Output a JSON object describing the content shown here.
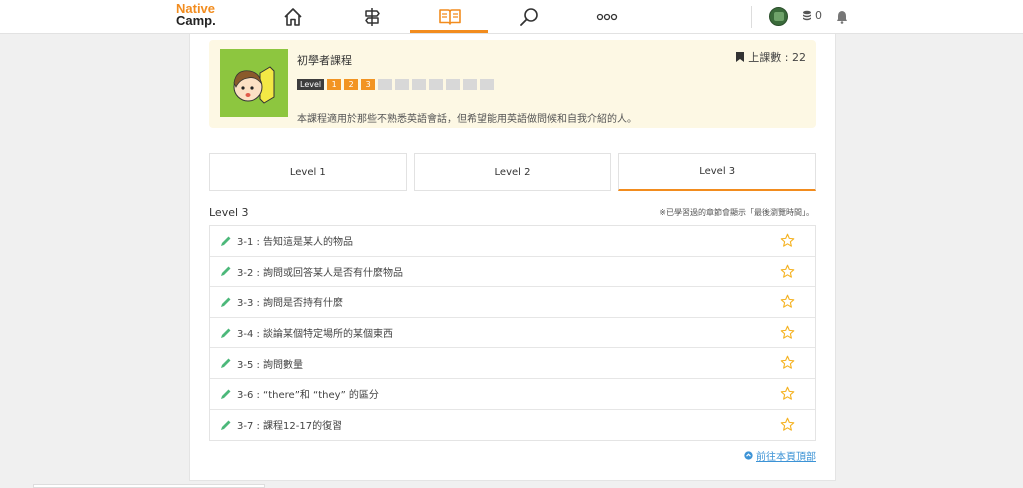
{
  "brand": {
    "line1": "Native",
    "line2": "Camp."
  },
  "nav": {
    "icons": [
      "home-icon",
      "signpost-icon",
      "book-icon",
      "search-icon",
      "more-icon",
      "bell-icon"
    ],
    "coins": "0"
  },
  "course": {
    "title": "初學者課程",
    "lesson_count_label": "上課數 : 22",
    "level_tag": "Level",
    "levels": [
      "1",
      "2",
      "3"
    ],
    "description": "本課程適用於那些不熟悉英語會話，但希望能用英語做問候和自我介紹的人。"
  },
  "tabs": [
    "Level 1",
    "Level 2",
    "Level 3"
  ],
  "section": {
    "title": "Level 3",
    "note": "※已學習過的章節會顯示「最後瀏覽時間」。"
  },
  "lessons": [
    "3-1 : 告知這是某人的物品",
    "3-2 : 詢問或回答某人是否有什麼物品",
    "3-3 : 詢問是否持有什麼",
    "3-4 : 談論某個特定場所的某個東西",
    "3-5 : 詢問數量",
    "3-6 : “there”和 “they” 的區分",
    "3-7 : 課程12-17的復習"
  ],
  "back_to_top": "前往本頁頂部",
  "colors": {
    "accent": "#f28c1e",
    "green": "#8dc63f",
    "link": "#3c93d6",
    "star": "#f5b324",
    "pencil": "#4cb87a"
  }
}
